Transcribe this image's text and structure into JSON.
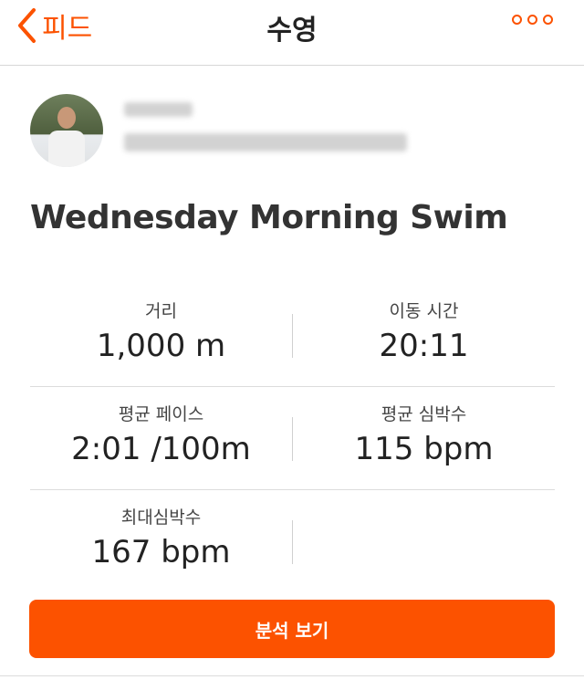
{
  "nav": {
    "back_label": "피드",
    "title": "수영"
  },
  "activity": {
    "title": "Wednesday Morning Swim"
  },
  "stats": [
    {
      "label": "거리",
      "value": "1,000 m"
    },
    {
      "label": "이동 시간",
      "value": "20:11"
    },
    {
      "label": "평균 페이스",
      "value": "2:01 /100m"
    },
    {
      "label": "평균 심박수",
      "value": "115 bpm"
    },
    {
      "label": "최대심박수",
      "value": "167 bpm"
    }
  ],
  "actions": {
    "analysis_label": "분석 보기"
  },
  "colors": {
    "accent": "#fc5200"
  }
}
